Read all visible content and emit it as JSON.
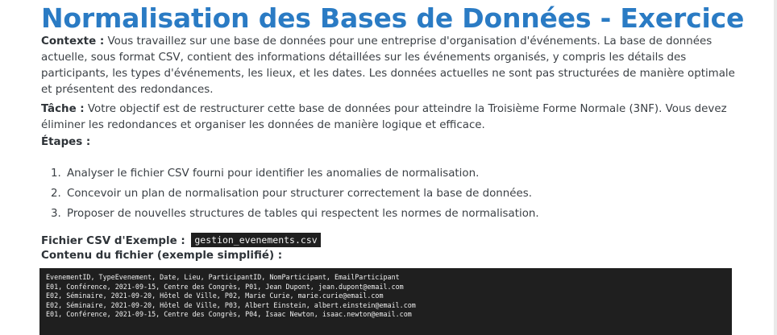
{
  "title": "Normalisation des Bases de Données - Exercice",
  "context": {
    "label": "Contexte :",
    "text": " Vous travaillez sur une base de données pour une entreprise d'organisation d'événements. La base de données actuelle, sous format CSV, contient des informations détaillées sur les événements organisés, y compris les détails des participants, les types d'événements, les lieux, et les dates. Les données actuelles ne sont pas structurées de manière optimale et présentent des redondances."
  },
  "task": {
    "label": "Tâche :",
    "text": " Votre objectif est de restructurer cette base de données pour atteindre la Troisième Forme Normale (3NF). Vous devez éliminer les redondances et organiser les données de manière logique et efficace."
  },
  "steps": {
    "label": "Étapes :",
    "items": [
      {
        "num": "1.",
        "text": "Analyser le fichier CSV fourni pour identifier les anomalies de normalisation."
      },
      {
        "num": "2.",
        "text": "Concevoir un plan de normalisation pour structurer correctement la base de données."
      },
      {
        "num": "3.",
        "text": "Proposer de nouvelles structures de tables qui respectent les normes de normalisation."
      }
    ]
  },
  "file": {
    "label": "Fichier CSV d'Exemple :",
    "name": "gestion_evenements.csv",
    "content_label": "Contenu du fichier (exemple simplifié) :"
  },
  "csv_lines": [
    "EvenementID, TypeEvenement, Date, Lieu, ParticipantID, NomParticipant, EmailParticipant",
    "E01, Conférence, 2021-09-15, Centre des Congrès, P01, Jean Dupont, jean.dupont@email.com",
    "E02, Séminaire, 2021-09-20, Hôtel de Ville, P02, Marie Curie, marie.curie@email.com",
    "E02, Séminaire, 2021-09-20, Hôtel de Ville, P03, Albert Einstein, albert.einstein@email.com",
    "E01, Conférence, 2021-09-15, Centre des Congrès, P04, Isaac Newton, isaac.newton@email.com"
  ],
  "colors": {
    "title": "#2a7bc4",
    "code_background": "#1f1f1f",
    "code_text": "#f0f0f0"
  }
}
